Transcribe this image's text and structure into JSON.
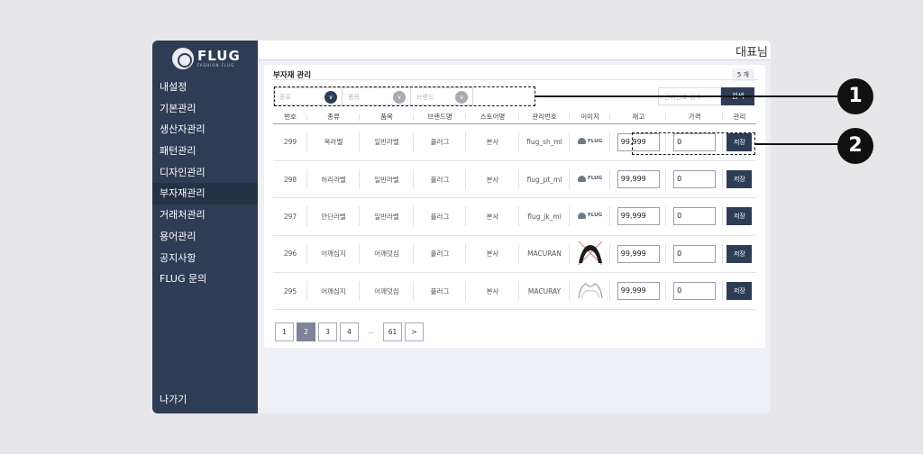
{
  "app": {
    "logo": {
      "name": "FLUG",
      "tagline": "FASHION FLUG"
    },
    "user_label": "대표님",
    "menu": [
      "내설정",
      "기본관리",
      "생산자관리",
      "패턴관리",
      "디자인관리",
      "부자재관리",
      "거래처관리",
      "용어관리",
      "공지사항",
      "FLUG 문의"
    ],
    "active_menu": "부자재관리",
    "exit_label": "나가기"
  },
  "panel": {
    "title": "부자재 관리",
    "count": "5 개",
    "filters": [
      {
        "placeholder": "종류"
      },
      {
        "placeholder": "품목"
      },
      {
        "placeholder": "브랜드"
      }
    ],
    "search_placeholder": "관리번호 검색",
    "search_label": "검색",
    "columns": [
      "번호",
      "종류",
      "품목",
      "브랜드명",
      "스토어명",
      "관리번호",
      "이미지",
      "재고",
      "가격",
      "관리"
    ],
    "rows": [
      {
        "no": "299",
        "kind": "목라벨",
        "item": "일반라벨",
        "brand": "플러그",
        "store": "본사",
        "code": "flug_sh_ml",
        "image": "flug-logo",
        "stock": "99,999",
        "price": "0",
        "action": "저장"
      },
      {
        "no": "298",
        "kind": "허리라벨",
        "item": "일반라벨",
        "brand": "플러그",
        "store": "본사",
        "code": "flug_pt_ml",
        "image": "flug-logo",
        "stock": "99,999",
        "price": "0",
        "action": "저장"
      },
      {
        "no": "297",
        "kind": "안단라벨",
        "item": "일반라벨",
        "brand": "플러그",
        "store": "본사",
        "code": "flug_jk_ml",
        "image": "flug-logo",
        "stock": "99,999",
        "price": "0",
        "action": "저장"
      },
      {
        "no": "296",
        "kind": "어깨심지",
        "item": "어깨덧심",
        "brand": "플러그",
        "store": "본사",
        "code": "MACURAN",
        "image": "shoulder-pad-black",
        "stock": "99,999",
        "price": "0",
        "action": "저장"
      },
      {
        "no": "295",
        "kind": "어깨심지",
        "item": "어깨덧심",
        "brand": "플러그",
        "store": "본사",
        "code": "MACURAY",
        "image": "shoulder-pad-white",
        "stock": "99,999",
        "price": "0",
        "action": "저장"
      }
    ],
    "pagination": [
      "1",
      "2",
      "3",
      "4",
      "...",
      "61",
      ">"
    ],
    "current_page": "2",
    "flug_image_text": "FLUG"
  },
  "callouts": [
    "1",
    "2"
  ]
}
